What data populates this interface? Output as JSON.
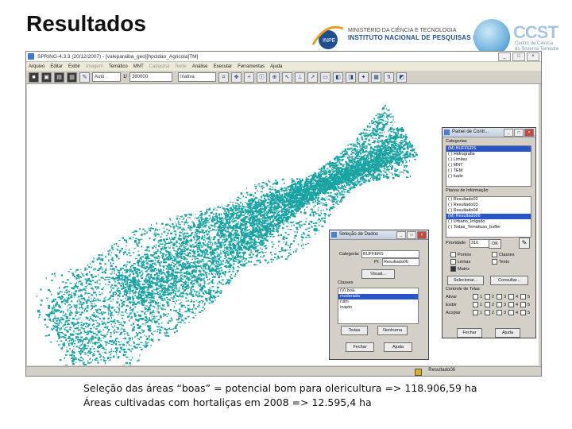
{
  "slide": {
    "title": "Resultados",
    "caption_line1": "Seleção das áreas “boas” = potencial bom para olericultura => 118.906,59 ha",
    "caption_line2": "Áreas cultivadas com hortaliças em 2008 => 12.595,4 ha"
  },
  "logos": {
    "inpe_line1": "MINISTÉRIO DA CIÊNCIA E TECNOLOGIA",
    "inpe_line2": "INSTITUTO NACIONAL DE PESQUISAS ESPACIAIS",
    "ccst_name": "CCST",
    "ccst_sub1": "Centro de Ciência",
    "ccst_sub2": "do Sistema Terrestre"
  },
  "app": {
    "window_title": "SPRING-4.3.3 (20/12/2007) - [valeparaiba_geo][hpcidao_Agricola]TM]",
    "menu": [
      "Arquivo",
      "Editar",
      "Exibir",
      "Imagem",
      "Temático",
      "MNT",
      "Cadastral",
      "Rede",
      "Análise",
      "Executar",
      "Ferramentas",
      "Ajuda"
    ],
    "menu_disabled": [
      3,
      6,
      7
    ],
    "toolbar": {
      "zoom_select": "Auto",
      "scale_prefix": "1/",
      "scale_value": "380000",
      "mode_select": "Inativa"
    },
    "status": {
      "active_plan": "Resultado06"
    },
    "accent_color": "#1aa3a3"
  },
  "panel_control": {
    "title": "Painel de Contr...",
    "categories_label": "Categorias",
    "categories": [
      {
        "text": "(M) BUFFERS",
        "selected": true
      },
      {
        "text": "( ) Hidrografia",
        "selected": false
      },
      {
        "text": "( ) Limites",
        "selected": false
      },
      {
        "text": "( ) MNT",
        "selected": false
      },
      {
        "text": "( ) TEM",
        "selected": false
      },
      {
        "text": "( ) Iuate",
        "selected": false
      }
    ],
    "plans_label": "Planos de Informação",
    "plans": [
      {
        "text": "( ) Resultado02",
        "selected": false
      },
      {
        "text": "( ) Resultado03",
        "selected": false
      },
      {
        "text": "( ) Resultado04",
        "selected": false
      },
      {
        "text": "(M) Resultado06",
        "selected": true
      },
      {
        "text": "( ) Urbano_Irrigado",
        "selected": false
      },
      {
        "text": "( ) Todas_Tematicas_buffer",
        "selected": false
      }
    ],
    "priority_label": "Prioridade",
    "priority_value": "310",
    "ok_label": "OK",
    "opts": {
      "pontos": "Pontos",
      "classes": "Classes",
      "linhas": "Linhas",
      "texto": "Texto",
      "matriz": "Matriz"
    },
    "select_label": "Selecionar...",
    "consult_label": "Consultar...",
    "tela_label": "Controle de Telas",
    "tela_rows": [
      "Ativar",
      "Exibir",
      "Acoplar"
    ],
    "tela_nums": [
      "1",
      "2",
      "3",
      "4",
      "5"
    ],
    "ajuda_label": "Ajuda",
    "close_label": "Fechar",
    "help_label": "Ajuda"
  },
  "selection_dialog": {
    "title": "Seleção de Dados",
    "category_label": "Categoria:",
    "category_value": "BUFFERS",
    "pi_label": "PI:",
    "pi_value": "Resultado06",
    "visual_button": "Visual...",
    "classes_label": "Classes",
    "classes": [
      {
        "text": "(V) boa",
        "selected": false
      },
      {
        "text": "moderada",
        "selected": true
      },
      {
        "text": "ruim",
        "selected": false
      },
      {
        "text": "inapto",
        "selected": false
      }
    ],
    "all_button": "Todas",
    "none_button": "Nenhuma",
    "close_button": "Fechar",
    "help_button": "Ajuda"
  }
}
